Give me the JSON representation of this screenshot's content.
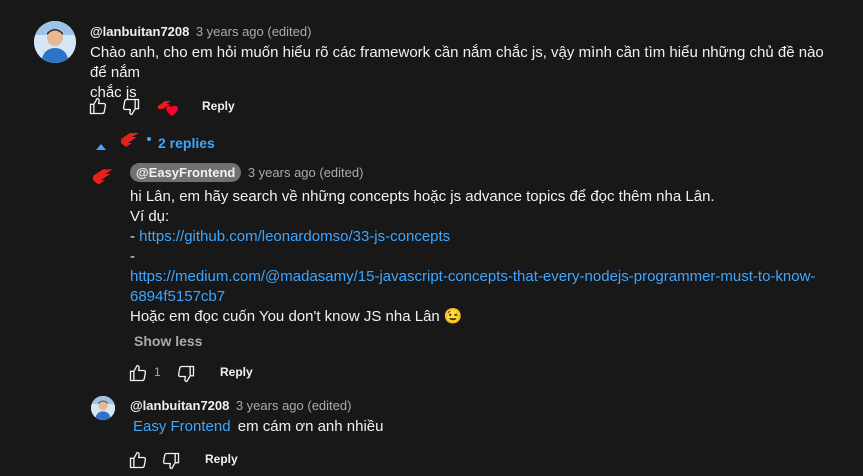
{
  "comment": {
    "author": "@lanbuitan7208",
    "time": "3 years ago (edited)",
    "text_line1": "Chào anh, cho em hỏi muốn hiểu rõ các framework cần nắm chắc js, vậy mình cần tìm hiểu những chủ đề nào để nắm",
    "text_line2": "chắc js",
    "reply_label": "Reply",
    "replies_label": "2 replies"
  },
  "reply1": {
    "author": "@EasyFrontend",
    "time": "3 years ago (edited)",
    "line1": "hi Lân, em hãy search về những concepts hoặc js advance topics để đọc thêm nha Lân.",
    "line2": "Ví dụ:",
    "dash1": "- ",
    "link1": "https://github.com/leonardomso/33-js-concepts",
    "dash2": "-",
    "link2_line1": "https://medium.com/@madasamy/15-javascript-concepts-that-every-nodejs-programmer-must-to-know-",
    "link2_line2": "6894f5157cb7",
    "line_last": "Hoặc em đọc cuốn You don't know JS nha Lân",
    "emoji": "😉",
    "show_less": "Show less",
    "like_count": "1",
    "reply_label": "Reply"
  },
  "reply2": {
    "author": "@lanbuitan7208",
    "time": "3 years ago (edited)",
    "mention": "Easy Frontend",
    "text": "em cám ơn anh nhiều",
    "reply_label": "Reply"
  },
  "colors": {
    "background": "#181818",
    "link": "#3ea6ff",
    "brand_red": "#e62117"
  },
  "icons": [
    "thumbs-up-icon",
    "thumbs-down-icon",
    "creator-heart-icon",
    "chevron-up-icon",
    "easyfrontend-logo-icon"
  ]
}
